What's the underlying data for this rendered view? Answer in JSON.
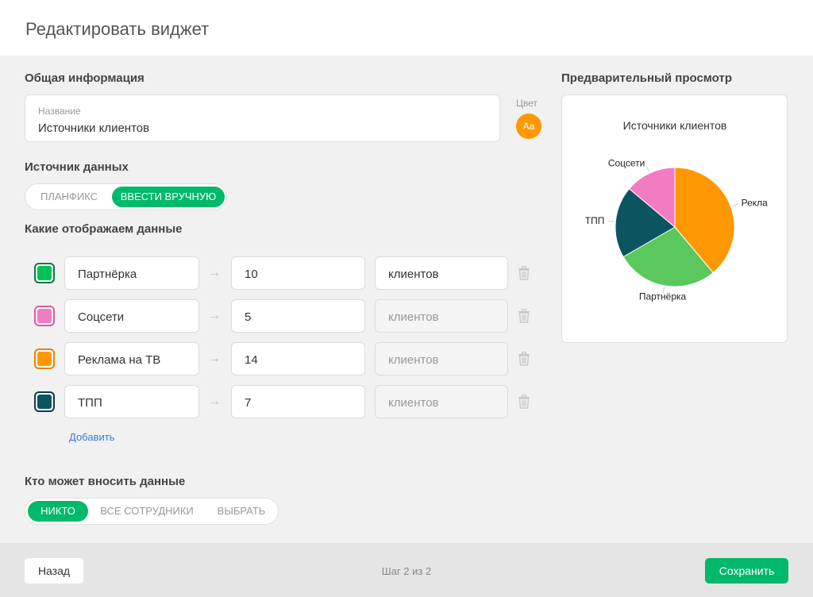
{
  "header": {
    "title": "Редактировать виджет"
  },
  "general": {
    "section_title": "Общая информация",
    "name_label": "Название",
    "name_value": "Источники клиентов",
    "color_label": "Цвет",
    "color_swatch_text": "Aa",
    "color_value": "#ff9800"
  },
  "source": {
    "section_title": "Источник данных",
    "options": [
      "ПЛАНФИКС",
      "ВВЕСТИ ВРУЧНУЮ"
    ],
    "selected": "ВВЕСТИ ВРУЧНУЮ"
  },
  "data_section": {
    "section_title": "Какие отображаем данные",
    "rows": [
      {
        "name": "Партнёрка",
        "value": "10",
        "unit": "клиентов",
        "color": "#00c357",
        "border": "#0a7d3b",
        "unit_disabled": false
      },
      {
        "name": "Соцсети",
        "value": "5",
        "unit": "клиентов",
        "color": "#f27bc1",
        "border": "#e056a8",
        "unit_disabled": true
      },
      {
        "name": "Реклама на ТВ",
        "value": "14",
        "unit": "клиентов",
        "color": "#ff9800",
        "border": "#e08600",
        "unit_disabled": true
      },
      {
        "name": "ТПП",
        "value": "7",
        "unit": "клиентов",
        "color": "#0b5560",
        "border": "#083c44",
        "unit_disabled": true
      }
    ],
    "add_link": "Добавить"
  },
  "access": {
    "section_title": "Кто может вносить данные",
    "options": [
      "НИКТО",
      "ВСЕ СОТРУДНИКИ",
      "ВЫБРАТЬ"
    ],
    "selected": "НИКТО"
  },
  "preview": {
    "section_title": "Предварительный просмотр",
    "chart_data": {
      "type": "pie",
      "title": "Источники клиентов",
      "categories": [
        "Реклама на ТВ",
        "Партнёрка",
        "ТПП",
        "Соцсети"
      ],
      "visible_labels": [
        "Рекла",
        "Партнёрка",
        "ТПП",
        "Соцсети"
      ],
      "values": [
        14,
        10,
        7,
        5
      ],
      "colors": [
        "#ff9800",
        "#5bc85d",
        "#0b5560",
        "#f27bc1"
      ]
    }
  },
  "footer": {
    "back_label": "Назад",
    "step_text": "Шаг 2 из 2",
    "save_label": "Сохранить"
  }
}
